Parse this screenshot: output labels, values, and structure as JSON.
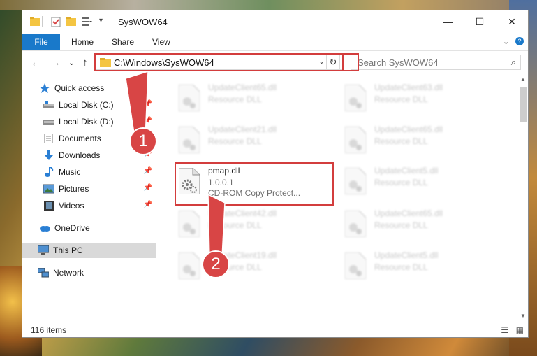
{
  "window": {
    "title": "SysWOW64",
    "controls": {
      "minimize": "—",
      "maximize": "☐",
      "close": "✕"
    }
  },
  "ribbon": {
    "file_tab": "File",
    "tabs": [
      "Home",
      "Share",
      "View"
    ],
    "expand_glyph": "⌄",
    "help_glyph": "?"
  },
  "nav_buttons": {
    "back": "←",
    "forward": "→",
    "recent": "⌄",
    "up": "↑"
  },
  "address": {
    "path": "C:\\Windows\\SysWOW64",
    "dropdown": "⌄",
    "refresh": "↻"
  },
  "search": {
    "placeholder": "Search SysWOW64",
    "icon": "⌕"
  },
  "sidebar": {
    "items": [
      {
        "label": "Quick access",
        "icon": "star-icon",
        "pinned": false
      },
      {
        "label": "Local Disk (C:)",
        "icon": "drive-icon",
        "pinned": true
      },
      {
        "label": "Local Disk (D:)",
        "icon": "drive-icon",
        "pinned": true
      },
      {
        "label": "Documents",
        "icon": "documents-icon",
        "pinned": true
      },
      {
        "label": "Downloads",
        "icon": "download-icon",
        "pinned": true
      },
      {
        "label": "Music",
        "icon": "music-icon",
        "pinned": true
      },
      {
        "label": "Pictures",
        "icon": "pictures-icon",
        "pinned": true
      },
      {
        "label": "Videos",
        "icon": "videos-icon",
        "pinned": true
      },
      {
        "label": "OneDrive",
        "icon": "cloud-icon",
        "pinned": false
      },
      {
        "label": "This PC",
        "icon": "computer-icon",
        "pinned": false,
        "selected": true
      },
      {
        "label": "Network",
        "icon": "network-icon",
        "pinned": false
      }
    ]
  },
  "files": [
    {
      "name": "UpdateClient65.dll",
      "type": "Resource DLL",
      "blurred": true
    },
    {
      "name": "UpdateClient63.dll",
      "type": "Resource DLL",
      "blurred": true
    },
    {
      "name": "UpdateClient21.dll",
      "type": "Resource DLL",
      "blurred": true
    },
    {
      "name": "UpdateClient65.dll",
      "type": "Resource DLL",
      "blurred": true
    },
    {
      "name": "pmap.dll",
      "version": "1.0.0.1",
      "type": "CD-ROM Copy Protect...",
      "blurred": false
    },
    {
      "name": "UpdateClient5.dll",
      "type": "Resource DLL",
      "blurred": true
    },
    {
      "name": "UpdateClient42.dll",
      "type": "Resource DLL",
      "blurred": true
    },
    {
      "name": "UpdateClient65.dll",
      "type": "Resource DLL",
      "blurred": true
    },
    {
      "name": "UpdateClient19.dll",
      "type": "Resource DLL",
      "blurred": true
    },
    {
      "name": "UpdateClient5.dll",
      "type": "Resource DLL",
      "blurred": true
    }
  ],
  "status": {
    "item_count": "116 items",
    "view_details": "☰",
    "view_icons": "▦"
  },
  "annotations": {
    "step1": "1",
    "step2": "2",
    "color": "#d84545"
  }
}
